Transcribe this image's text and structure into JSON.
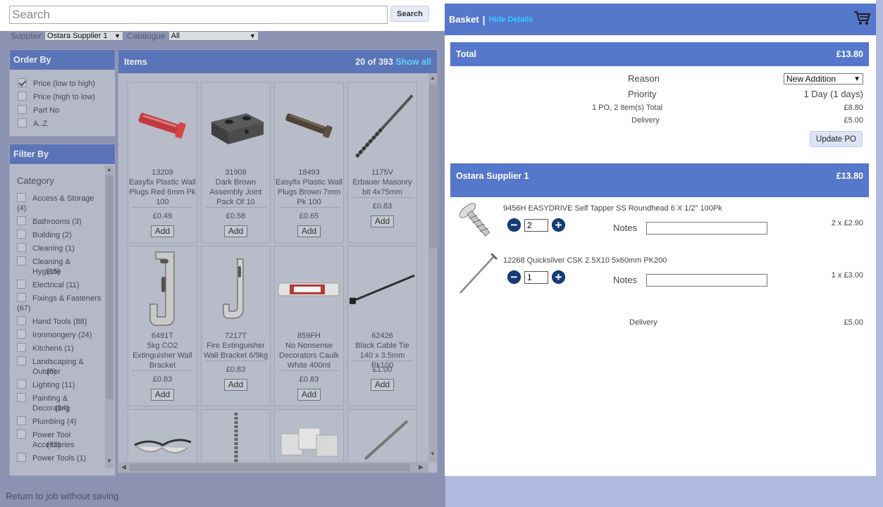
{
  "search": {
    "placeholder": "Search",
    "button": "Search"
  },
  "filters": {
    "supplier_label": "Supplier",
    "supplier_value": "Ostara Supplier 1",
    "catalogue_label": "Catalogue",
    "catalogue_value": "All"
  },
  "order_by": {
    "title": "Order By",
    "options": [
      {
        "label": "Price (low to high)",
        "checked": true
      },
      {
        "label": "Price (high to low)",
        "checked": false
      },
      {
        "label": "Part No",
        "checked": false
      },
      {
        "label": "A..Z",
        "checked": false
      }
    ]
  },
  "filter_by": {
    "title": "Filter By",
    "category_label": "Category",
    "categories": [
      {
        "name": "Access & Storage",
        "count": "(4)"
      },
      {
        "name": "Bathrooms",
        "count": "(3)"
      },
      {
        "name": "Building",
        "count": "(2)"
      },
      {
        "name": "Cleaning",
        "count": "(1)"
      },
      {
        "name": "Cleaning & Hygiene",
        "count": "(15)"
      },
      {
        "name": "Electrical",
        "count": "(11)"
      },
      {
        "name": "Fixings & Fasteners",
        "count": "(67)"
      },
      {
        "name": "Hand Tools",
        "count": "(88)"
      },
      {
        "name": "Ironmongery",
        "count": "(24)"
      },
      {
        "name": "Kitchens",
        "count": "(1)"
      },
      {
        "name": "Landscaping & Outdoor",
        "count": "(6)"
      },
      {
        "name": "Lighting",
        "count": "(11)"
      },
      {
        "name": "Painting & Decorating",
        "count": "(14)"
      },
      {
        "name": "Plumbing",
        "count": "(4)"
      },
      {
        "name": "Power Tool Accessories",
        "count": "(32)"
      },
      {
        "name": "Power Tools",
        "count": "(1)"
      }
    ]
  },
  "items": {
    "title": "Items",
    "count": "20 of 393",
    "show_all": "Show all",
    "add_label": "Add",
    "list": [
      {
        "code": "13209",
        "name": "Easyfix Plastic Wall Plugs Red 6mm Pk 100",
        "price": "£0.49",
        "icon": "red-wall-plug-icon"
      },
      {
        "code": "31908",
        "name": "Dark Brown Assembly Joint Pack Of 10",
        "price": "£0.58",
        "icon": "assembly-joint-icon"
      },
      {
        "code": "18493",
        "name": "Easyfix Plastic Wall Plugs Brown 7mm Pk 100",
        "price": "£0.65",
        "icon": "brown-wall-plug-icon"
      },
      {
        "code": "1175V",
        "name": "Erbauer Masonry bit 4x75mm",
        "price": "£0.83",
        "icon": "drill-bit-icon"
      },
      {
        "code": "6491T",
        "name": "5kg CO2 Extinguisher Wall Bracket",
        "price": "£0.83",
        "icon": "wall-bracket-icon"
      },
      {
        "code": "7217T",
        "name": "Fire Extinguisher Wall Bracket 6/9kg",
        "price": "£0.83",
        "icon": "hook-bracket-icon"
      },
      {
        "code": "859FH",
        "name": "No Nonsense Decorators Caulk White 400ml",
        "price": "£0.83",
        "icon": "caulk-tube-icon"
      },
      {
        "code": "62426",
        "name": "Black Cable Tie 140 x 3.5mm Pk100",
        "price": "£1.00",
        "icon": "cable-tie-icon"
      }
    ]
  },
  "footer": {
    "return_link": "Return to job without saving"
  },
  "basket": {
    "title": "Basket",
    "separator": "|",
    "toggle": "Hide Details",
    "total_label": "Total",
    "total_value": "£13.80",
    "reason_label": "Reason",
    "reason_value": "New Addition",
    "priority_label": "Priority",
    "priority_value": "1 Day (1 days)",
    "po_summary_label": "1 PO, 2 item(s) Total",
    "po_summary_value": "£8.80",
    "delivery_label": "Delivery",
    "delivery_value": "£5.00",
    "update_button": "Update PO",
    "supplier": {
      "name": "Ostara Supplier 1",
      "total": "£13.80"
    },
    "lines": [
      {
        "description": "9456H EASYDRIVE Self Tapper SS Roundhead 6 X 1/2\" 100Pk",
        "qty": "2",
        "notes_label": "Notes",
        "line_price": "2 x £2.90",
        "icon": "screw-icon"
      },
      {
        "description": "12268 Quicksilver CSK 2.5X10 5x60mm PK200",
        "qty": "1",
        "notes_label": "Notes",
        "line_price": "1 x £3.00",
        "icon": "nail-icon"
      }
    ],
    "supplier_delivery_label": "Delivery",
    "supplier_delivery_value": "£5.00"
  },
  "colors": {
    "accent": "#5577cc",
    "link": "#33ccff",
    "stepper": "#163d79"
  }
}
